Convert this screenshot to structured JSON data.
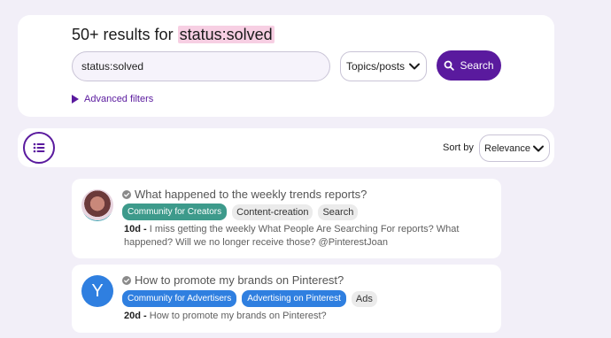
{
  "search": {
    "heading_prefix": "50+ results for",
    "heading_term": "status:solved",
    "query_value": "status:solved",
    "scope_selected": "Topics/posts",
    "search_label": "Search",
    "advanced_filters_label": "Advanced filters"
  },
  "toolbar": {
    "sort_by_label": "Sort by",
    "sort_selected": "Relevance"
  },
  "colors": {
    "accent": "#5a1a9e",
    "highlight": "#f7cfe3",
    "category_creators": "#3d9a8b",
    "category_advertisers": "#2f7fe0"
  },
  "results": [
    {
      "title": "What happened to the weekly trends reports?",
      "category": "Community for Creators",
      "tags": [
        "Content-creation",
        "Search"
      ],
      "age": "10d",
      "excerpt_line1": "I miss getting the weekly What People Are Searching For reports? What",
      "excerpt_line2": "happened? Will we no longer receive those? @PinterestJoan"
    },
    {
      "avatar_letter": "Y",
      "title": "How to promote my brands on Pinterest?",
      "category": "Community for Advertisers",
      "category2": "Advertising on Pinterest",
      "tags": [
        "Ads"
      ],
      "age": "20d",
      "excerpt_line1": "How to promote my brands on Pinterest?"
    }
  ]
}
